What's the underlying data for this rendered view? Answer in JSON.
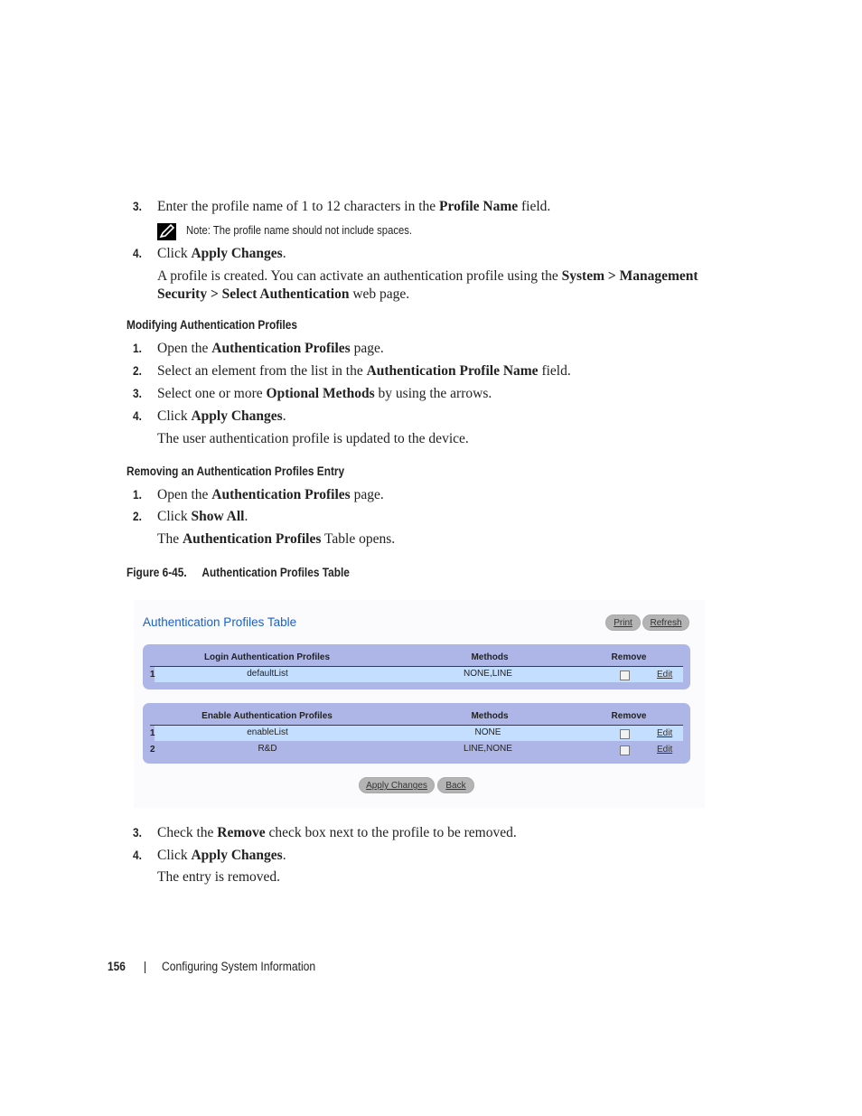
{
  "section_create": {
    "steps": [
      {
        "num": "3.",
        "pre": "Enter the profile name of 1 to 12 characters in the ",
        "bold": "Profile Name",
        "post": " field."
      },
      {
        "num": "4.",
        "pre": "Click ",
        "bold": "Apply Changes",
        "post": "."
      }
    ],
    "note": {
      "label": "Note:",
      "text": " The profile name should not include spaces."
    },
    "result": {
      "line1_pre": "A profile is created. You can activate an authentication profile using the ",
      "line1_bold": "System > Management",
      "line2_bold": "Security > Select Authentication",
      "line2_post": " web page."
    }
  },
  "section_modify": {
    "heading": "Modifying Authentication Profiles",
    "steps": [
      {
        "num": "1.",
        "pre": "Open the ",
        "bold": "Authentication Profiles",
        "post": " page."
      },
      {
        "num": "2.",
        "pre": "Select an element from the list in the ",
        "bold": "Authentication Profile Name",
        "post": " field."
      },
      {
        "num": "3.",
        "pre": "Select one or more ",
        "bold": "Optional Methods",
        "post": " by using the arrows."
      },
      {
        "num": "4.",
        "pre": "Click ",
        "bold": "Apply Changes",
        "post": "."
      }
    ],
    "result": "The user authentication profile is updated to the device."
  },
  "section_remove": {
    "heading": "Removing an Authentication Profiles Entry",
    "steps": [
      {
        "num": "1.",
        "pre": "Open the ",
        "bold": "Authentication Profiles",
        "post": " page."
      },
      {
        "num": "2.",
        "pre": "Click ",
        "bold": "Show All",
        "post": "."
      }
    ],
    "result": {
      "pre": "The ",
      "bold": "Authentication Profiles",
      "post": " Table opens."
    },
    "figure_caption": {
      "label": "Figure 6-45.",
      "title": "Authentication Profiles Table"
    },
    "steps_after": [
      {
        "num": "3.",
        "pre": "Check the ",
        "bold": "Remove",
        "post": " check box next to the profile to be removed."
      },
      {
        "num": "4.",
        "pre": "Click ",
        "bold": "Apply Changes",
        "post": "."
      }
    ],
    "final": "The entry is removed."
  },
  "figure": {
    "title": "Authentication Profiles Table",
    "buttons": {
      "print": "Print",
      "refresh": "Refresh",
      "apply": "Apply Changes",
      "back": "Back"
    },
    "colors": {
      "title": "#1a5fd0",
      "panel": "#adb6e6",
      "row_highlight": "#c3deff",
      "button": "#b4b4b4"
    },
    "login_table": {
      "headers": {
        "name": "Login Authentication Profiles",
        "methods": "Methods",
        "remove": "Remove"
      },
      "rows": [
        {
          "index": "1",
          "name": "defaultList",
          "methods": "NONE,LINE",
          "remove": false,
          "edit": "Edit"
        }
      ]
    },
    "enable_table": {
      "headers": {
        "name": "Enable Authentication Profiles",
        "methods": "Methods",
        "remove": "Remove"
      },
      "rows": [
        {
          "index": "1",
          "name": "enableList",
          "methods": "NONE",
          "remove": false,
          "edit": "Edit"
        },
        {
          "index": "2",
          "name": "R&D",
          "methods": "LINE,NONE",
          "remove": false,
          "edit": "Edit"
        }
      ]
    }
  },
  "footer": {
    "page_number": "156",
    "chapter": "Configuring System Information"
  }
}
